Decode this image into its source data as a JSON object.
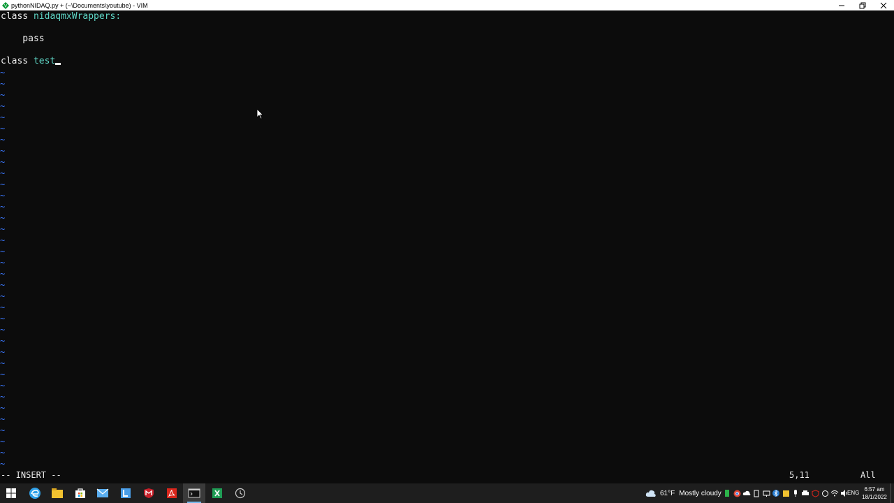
{
  "window": {
    "title": "pythonNIDAQ.py + (~\\Documents\\youtube) - VIM"
  },
  "buffer": {
    "lines": [
      {
        "keyword": "class",
        "name": "nidaqmxWrappers:"
      },
      {
        "text": ""
      },
      {
        "text": "    pass"
      },
      {
        "text": ""
      },
      {
        "keyword": "class",
        "name": "test"
      }
    ],
    "tilde": "~",
    "tilde_count": 36
  },
  "status": {
    "mode": "-- INSERT --",
    "position": "5,11",
    "scroll": "All"
  },
  "taskbar": {
    "apps": [
      {
        "name": "windows-start-icon",
        "color": "#ffffff"
      },
      {
        "name": "edge-icon",
        "color": "#2fa0e8"
      },
      {
        "name": "file-explorer-icon",
        "color": "#f2c230"
      },
      {
        "name": "store-icon",
        "color": "#5aaef0"
      },
      {
        "name": "mail-icon",
        "color": "#5aaef0"
      },
      {
        "name": "lync-icon",
        "color": "#4a9ee8"
      },
      {
        "name": "mcafee-icon",
        "color": "#c8202a"
      },
      {
        "name": "acrobat-icon",
        "color": "#d9261c"
      },
      {
        "name": "terminal-icon",
        "color": "#cccccc"
      },
      {
        "name": "excel-icon",
        "color": "#1f9d55"
      },
      {
        "name": "clock-app-icon",
        "color": "#cccccc"
      }
    ],
    "weather": {
      "temp": "61°F",
      "desc": "Mostly cloudy"
    },
    "language": "ENG",
    "time": "6:57 am",
    "date": "18/1/2022"
  },
  "colors": {
    "background": "#0c0c0c",
    "text": "#ececec",
    "class_name": "#5fd7c7",
    "tilde": "#3b78ff",
    "taskbar": "#1e1e1e"
  }
}
